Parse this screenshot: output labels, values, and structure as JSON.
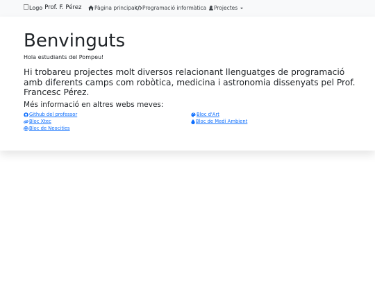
{
  "navbar": {
    "logo_alt": "Logo",
    "brand": "Prof. F. Pérez",
    "items": [
      {
        "label": "Pàgina principal",
        "icon": "home-icon"
      },
      {
        "label": "Programació informàtica",
        "icon": "code-icon",
        "dropdown": true
      },
      {
        "label": "Projectes",
        "icon": "person-icon",
        "dropdown": true
      }
    ]
  },
  "main": {
    "title": "Benvinguts",
    "subtitle": "Hola estudiants del Pompeu!",
    "lead": "Hi trobareu projectes molt diversos relacionant llenguatges de programació amb diferents camps com robòtica, medicina i astronomia dissenyats pel Prof. Francesc Pérez.",
    "more_info": "Més informació en altres webs meves:",
    "links": [
      {
        "label": "Github del professor",
        "icon": "github-icon"
      },
      {
        "label": "Bloc Xtec",
        "icon": "link-icon"
      },
      {
        "label": "Bloc de Neocities",
        "icon": "globe-icon"
      },
      {
        "label": "Bloc d'Art",
        "icon": "palette-icon"
      },
      {
        "label": "Bloc de Medi Ambient",
        "icon": "droplet-icon"
      }
    ]
  },
  "colors": {
    "link": "#0d6efd",
    "navbar_bg": "#f8f9fa",
    "text": "#212529"
  }
}
